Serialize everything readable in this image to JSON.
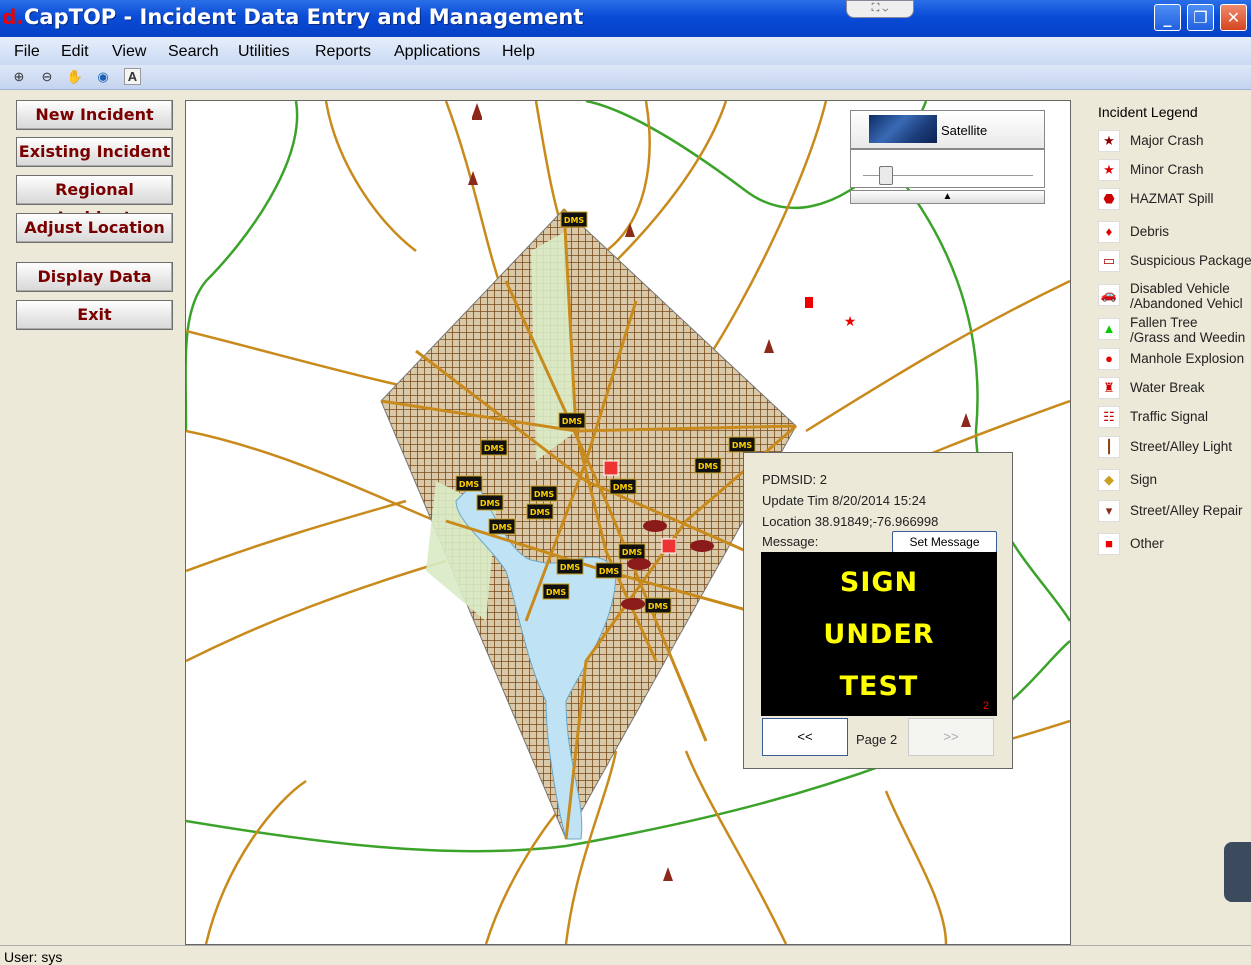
{
  "window": {
    "title": "CapTOP - Incident Data Entry and Management",
    "logo_letter": "d.",
    "tab_glyphs": "⛶ ⌄",
    "controls": {
      "minimize": "_",
      "restore": "❐",
      "close": "✕"
    }
  },
  "menu": [
    "File",
    "Edit",
    "View",
    "Search",
    "Utilities",
    "Reports",
    "Applications",
    "Help"
  ],
  "toolbar": {
    "tools": [
      "zoom-in",
      "zoom-out",
      "pan",
      "globe",
      "text"
    ],
    "glyphs": [
      "⊕",
      "⊖",
      "✋",
      "◉",
      "A"
    ]
  },
  "sidebar": {
    "new_incident": "New Incident",
    "existing_incident": "Existing Incident",
    "regional_incident": "Regional Incident",
    "adjust_location": "Adjust Location",
    "display_data": "Display Data",
    "exit": "Exit"
  },
  "map_controls": {
    "satellite_label": "Satellite",
    "expand_arrow": "▲"
  },
  "map_markers": {
    "dms_label": "DMS"
  },
  "popup": {
    "pdms_id": "PDMSID: 2",
    "update_time": "Update Tim 8/20/2014 15:24",
    "location": "Location 38.91849;-76.966998",
    "message_label": "Message:",
    "set_message_button": "Set Message",
    "sign_lines": [
      "SIGN",
      "UNDER",
      "TEST"
    ],
    "sign_number": "2",
    "prev_button": "<<",
    "page_label": "Page 2",
    "next_button": ">>"
  },
  "legend": {
    "title": "Incident Legend",
    "items": [
      {
        "label": "Major Crash",
        "icon": "star-icon",
        "glyph": "★",
        "color": "#8b0000"
      },
      {
        "label": "Minor Crash",
        "icon": "small-star-icon",
        "glyph": "★",
        "color": "#e00000"
      },
      {
        "label": "HAZMAT Spill",
        "icon": "hazmat-icon",
        "glyph": "⬣",
        "color": "#cc0000"
      },
      {
        "label": "Debris",
        "icon": "debris-icon",
        "glyph": "♦",
        "color": "#dd0000"
      },
      {
        "label": "Suspicious Package",
        "icon": "package-icon",
        "glyph": "▭",
        "color": "#aa0000"
      },
      {
        "label": "Disabled Vehicle",
        "label2": "/Abandoned Vehicl",
        "icon": "car-icon",
        "glyph": "🚗",
        "color": "#5a2a1a"
      },
      {
        "label": "Fallen Tree",
        "label2": "/Grass and Weedin",
        "icon": "triangle-icon",
        "glyph": "▲",
        "color": "#00cc00"
      },
      {
        "label": "Manhole Explosion",
        "icon": "manhole-icon",
        "glyph": "●",
        "color": "#ee0000"
      },
      {
        "label": "Water Break",
        "icon": "hydrant-icon",
        "glyph": "♜",
        "color": "#cc0000"
      },
      {
        "label": "Traffic Signal",
        "icon": "traffic-signal-icon",
        "glyph": "☷",
        "color": "#cc0000"
      },
      {
        "label": "Street/Alley Light",
        "icon": "street-light-icon",
        "glyph": "┃",
        "color": "#8b4513"
      },
      {
        "label": "Sign",
        "icon": "sign-icon",
        "glyph": "◆",
        "color": "#c9a020"
      },
      {
        "label": "Street/Alley Repair",
        "icon": "cone-icon",
        "glyph": "▾",
        "color": "#8b2a1a"
      },
      {
        "label": "Other",
        "icon": "square-icon",
        "glyph": "■",
        "color": "#ee0000"
      }
    ]
  },
  "status_bar": {
    "user": "User: sys"
  },
  "colors": {
    "road": "#c98a1c",
    "highway": "#3ba32a",
    "district": "#7a4a1a",
    "water": "#bfe3f5",
    "park": "#d9ebc6"
  }
}
